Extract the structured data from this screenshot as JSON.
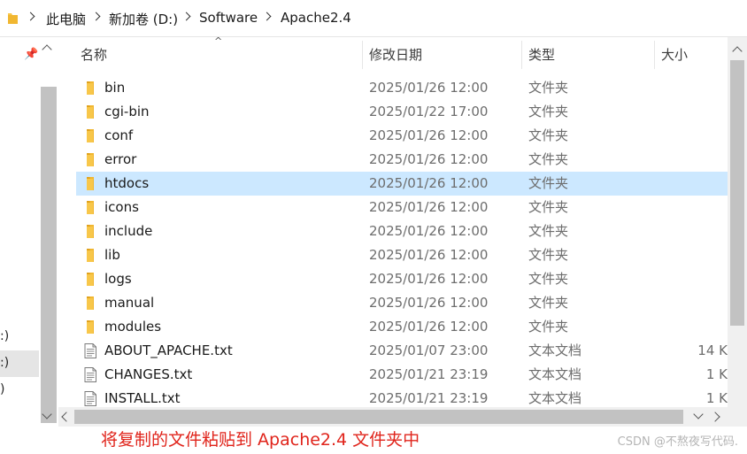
{
  "address": {
    "crumbs": [
      "此电脑",
      "新加卷 (D:)",
      "Software",
      "Apache2.4"
    ]
  },
  "nav": {
    "items": [
      ":)",
      ":)",
      ")"
    ]
  },
  "columns": {
    "name": "名称",
    "date": "修改日期",
    "type": "类型",
    "size": "大小"
  },
  "files": [
    {
      "name": "bin",
      "date": "2025/01/26 12:00",
      "type": "文件夹",
      "size": "",
      "icon": "folder-icon"
    },
    {
      "name": "cgi-bin",
      "date": "2025/01/22 17:00",
      "type": "文件夹",
      "size": "",
      "icon": "folder-icon"
    },
    {
      "name": "conf",
      "date": "2025/01/26 12:00",
      "type": "文件夹",
      "size": "",
      "icon": "folder-icon"
    },
    {
      "name": "error",
      "date": "2025/01/26 12:00",
      "type": "文件夹",
      "size": "",
      "icon": "folder-icon"
    },
    {
      "name": "htdocs",
      "date": "2025/01/26 12:00",
      "type": "文件夹",
      "size": "",
      "icon": "folder-icon",
      "selected": true
    },
    {
      "name": "icons",
      "date": "2025/01/26 12:00",
      "type": "文件夹",
      "size": "",
      "icon": "folder-icon"
    },
    {
      "name": "include",
      "date": "2025/01/26 12:00",
      "type": "文件夹",
      "size": "",
      "icon": "folder-icon"
    },
    {
      "name": "lib",
      "date": "2025/01/26 12:00",
      "type": "文件夹",
      "size": "",
      "icon": "folder-icon"
    },
    {
      "name": "logs",
      "date": "2025/01/26 12:00",
      "type": "文件夹",
      "size": "",
      "icon": "folder-icon"
    },
    {
      "name": "manual",
      "date": "2025/01/26 12:00",
      "type": "文件夹",
      "size": "",
      "icon": "folder-icon"
    },
    {
      "name": "modules",
      "date": "2025/01/26 12:00",
      "type": "文件夹",
      "size": "",
      "icon": "folder-icon"
    },
    {
      "name": "ABOUT_APACHE.txt",
      "date": "2025/01/07 23:00",
      "type": "文本文档",
      "size": "14 K",
      "icon": "text-file-icon"
    },
    {
      "name": "CHANGES.txt",
      "date": "2025/01/21 23:19",
      "type": "文本文档",
      "size": "1 K",
      "icon": "text-file-icon"
    },
    {
      "name": "INSTALL.txt",
      "date": "2025/01/21 23:19",
      "type": "文本文档",
      "size": "1 K",
      "icon": "text-file-icon"
    }
  ],
  "caption": "将复制的文件粘贴到 Apache2.4 文件夹中",
  "watermark": "CSDN @不熬夜写代码.",
  "colors": {
    "selection": "#cce8ff",
    "caption": "#e0241b",
    "folder": "#f8c74a"
  }
}
